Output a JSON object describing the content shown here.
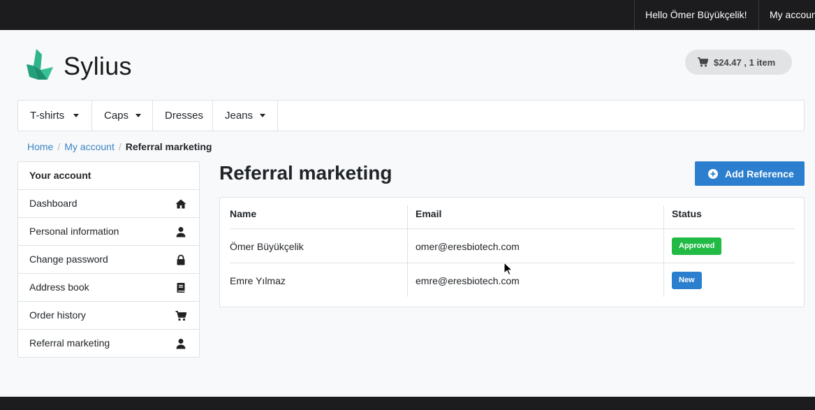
{
  "topbar": {
    "greeting": "Hello Ömer Büyükçelik!",
    "my_account": "My account"
  },
  "header": {
    "logo_text": "Sylius",
    "cart_label": "$24.47 , 1 item"
  },
  "menu": {
    "items": [
      {
        "label": "T-shirts",
        "has_dropdown": true
      },
      {
        "label": "Caps",
        "has_dropdown": true
      },
      {
        "label": "Dresses",
        "has_dropdown": false
      },
      {
        "label": "Jeans",
        "has_dropdown": true
      }
    ]
  },
  "breadcrumb": {
    "home": "Home",
    "account": "My account",
    "current": "Referral marketing"
  },
  "sidebar": {
    "header": "Your account",
    "items": [
      {
        "label": "Dashboard",
        "icon": "home-icon"
      },
      {
        "label": "Personal information",
        "icon": "user-icon"
      },
      {
        "label": "Change password",
        "icon": "lock-icon"
      },
      {
        "label": "Address book",
        "icon": "book-icon"
      },
      {
        "label": "Order history",
        "icon": "cart-icon"
      },
      {
        "label": "Referral marketing",
        "icon": "user-icon"
      }
    ]
  },
  "main": {
    "title": "Referral marketing",
    "add_button": "Add Reference",
    "table": {
      "headers": {
        "name": "Name",
        "email": "Email",
        "status": "Status"
      },
      "rows": [
        {
          "name": "Ömer Büyükçelik",
          "email": "omer@eresbiotech.com",
          "status": "Approved",
          "status_color": "#21ba45"
        },
        {
          "name": "Emre Yılmaz",
          "email": "emre@eresbiotech.com",
          "status": "New",
          "status_color": "#2c7fce"
        }
      ]
    }
  },
  "colors": {
    "accent": "#2c7fce",
    "link": "#3b84c5",
    "brand_green": "#1fa37c",
    "topbar": "#1c1c1e"
  }
}
